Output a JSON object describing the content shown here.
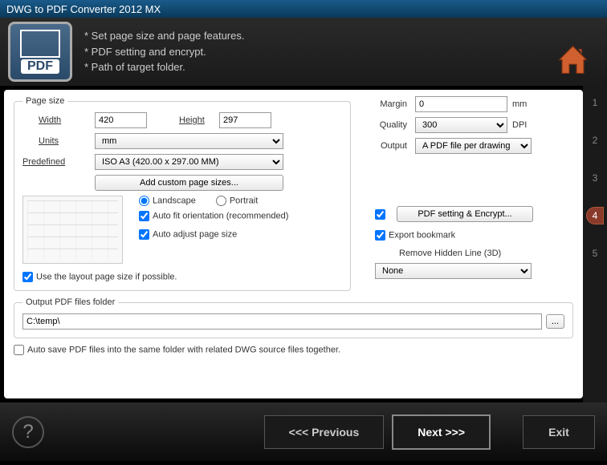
{
  "title": "DWG to PDF Converter 2012 MX",
  "header": {
    "line1": "* Set page size and page features.",
    "line2": "* PDF setting and encrypt.",
    "line3": "* Path of target folder.",
    "logo_text": "PDF"
  },
  "steps": {
    "s1": "1",
    "s2": "2",
    "s3": "3",
    "s4": "4",
    "s5": "5",
    "active": 4
  },
  "page_size": {
    "legend": "Page size",
    "width_label": "Width",
    "width_value": "420",
    "height_label": "Height",
    "height_value": "297",
    "units_label": "Units",
    "units_value": "mm",
    "predefined_label": "Predefined",
    "predefined_value": "ISO A3 (420.00 x 297.00 MM)",
    "add_custom_btn": "Add custom page sizes...",
    "landscape": "Landscape",
    "portrait": "Portrait",
    "orientation_selected": "landscape",
    "auto_fit": "Auto fit orientation (recommended)",
    "auto_fit_checked": true,
    "auto_adjust": "Auto adjust page size",
    "auto_adjust_checked": true,
    "use_layout": "Use the layout page size if possible.",
    "use_layout_checked": true
  },
  "right": {
    "margin_label": "Margin",
    "margin_value": "0",
    "margin_unit": "mm",
    "quality_label": "Quality",
    "quality_value": "300",
    "quality_unit": "DPI",
    "output_label": "Output",
    "output_value": "A PDF file per drawing",
    "pdf_encrypt_btn": "PDF setting & Encrypt...",
    "pdf_encrypt_checked": true,
    "export_bookmark": "Export bookmark",
    "export_bookmark_checked": true,
    "hidden_line_label": "Remove Hidden Line (3D)",
    "hidden_line_value": "None"
  },
  "output_folder": {
    "legend": "Output PDF files folder",
    "path": "C:\\temp\\",
    "browse": "..."
  },
  "autosave": {
    "label": "Auto save PDF files into the same folder with related DWG source files together.",
    "checked": false
  },
  "footer": {
    "help": "?",
    "prev": "<<<  Previous",
    "next": "Next  >>>",
    "exit": "Exit"
  }
}
